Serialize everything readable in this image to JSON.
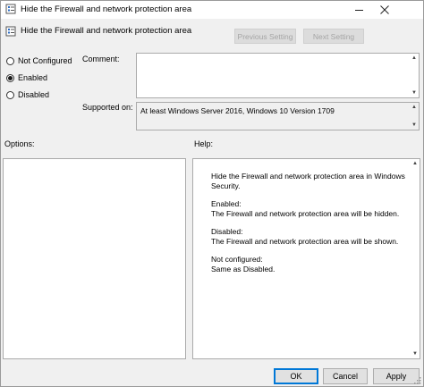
{
  "window": {
    "title": "Hide the Firewall and network protection area",
    "title_icon": "policy-settings-icon"
  },
  "header": {
    "setting_name": "Hide the Firewall and network protection area",
    "previous_label": "Previous Setting",
    "next_label": "Next Setting"
  },
  "state": {
    "options": [
      {
        "label": "Not Configured",
        "selected": false
      },
      {
        "label": "Enabled",
        "selected": true
      },
      {
        "label": "Disabled",
        "selected": false
      }
    ]
  },
  "comment": {
    "label": "Comment:",
    "value": ""
  },
  "supported_on": {
    "label": "Supported on:",
    "value": "At least Windows Server 2016, Windows 10 Version 1709"
  },
  "options_panel": {
    "label": "Options:"
  },
  "help_panel": {
    "label": "Help:",
    "intro": "Hide the Firewall and network protection area in Windows Security.",
    "enabled_heading": "Enabled:",
    "enabled_text": "The Firewall and network protection area will be hidden.",
    "disabled_heading": "Disabled:",
    "disabled_text": "The Firewall and network protection area will be shown.",
    "notconfigured_heading": "Not configured:",
    "notconfigured_text": "Same as Disabled."
  },
  "buttons": {
    "ok": "OK",
    "cancel": "Cancel",
    "apply": "Apply"
  },
  "colors": {
    "accent": "#0078d7",
    "window_bg": "#f0f0f0"
  }
}
